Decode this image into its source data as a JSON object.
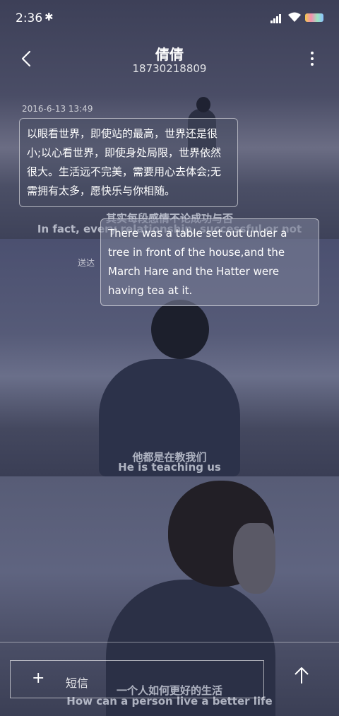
{
  "status_bar": {
    "time": "2:36",
    "bluetooth": "✱"
  },
  "header": {
    "contact_name": "倩倩",
    "phone": "18730218809"
  },
  "conversation": {
    "timestamp": "2016-6-13 13:49",
    "incoming": "以眼看世界，即使站的最高，世界还是很小;以心看世界，即使身处局限，世界依然很大。生活远不完美，需要用心去体会;无需拥有太多，愿快乐与你相随。",
    "outgoing": "There was a table set out under a tree in front of the house,and the March Hare and the Hatter were having tea at it.",
    "delivered_label": "送达"
  },
  "background_subtitles": {
    "panel1_cn": "其实每段感情不论成功与否",
    "panel1_en": "In fact, every relationship, successful or not",
    "panel2_cn": "他都是在教我们",
    "panel2_en": "He is teaching us",
    "panel3_cn": "一个人如何更好的生活",
    "panel3_en": "How can a person live a better life"
  },
  "composer": {
    "plus_symbol": "+",
    "placeholder": "短信"
  },
  "icons": [
    "bluetooth-icon",
    "signal-icon",
    "wifi-icon",
    "battery-icon",
    "back-arrow-icon",
    "more-icon",
    "add-icon",
    "send-arrow-icon"
  ]
}
